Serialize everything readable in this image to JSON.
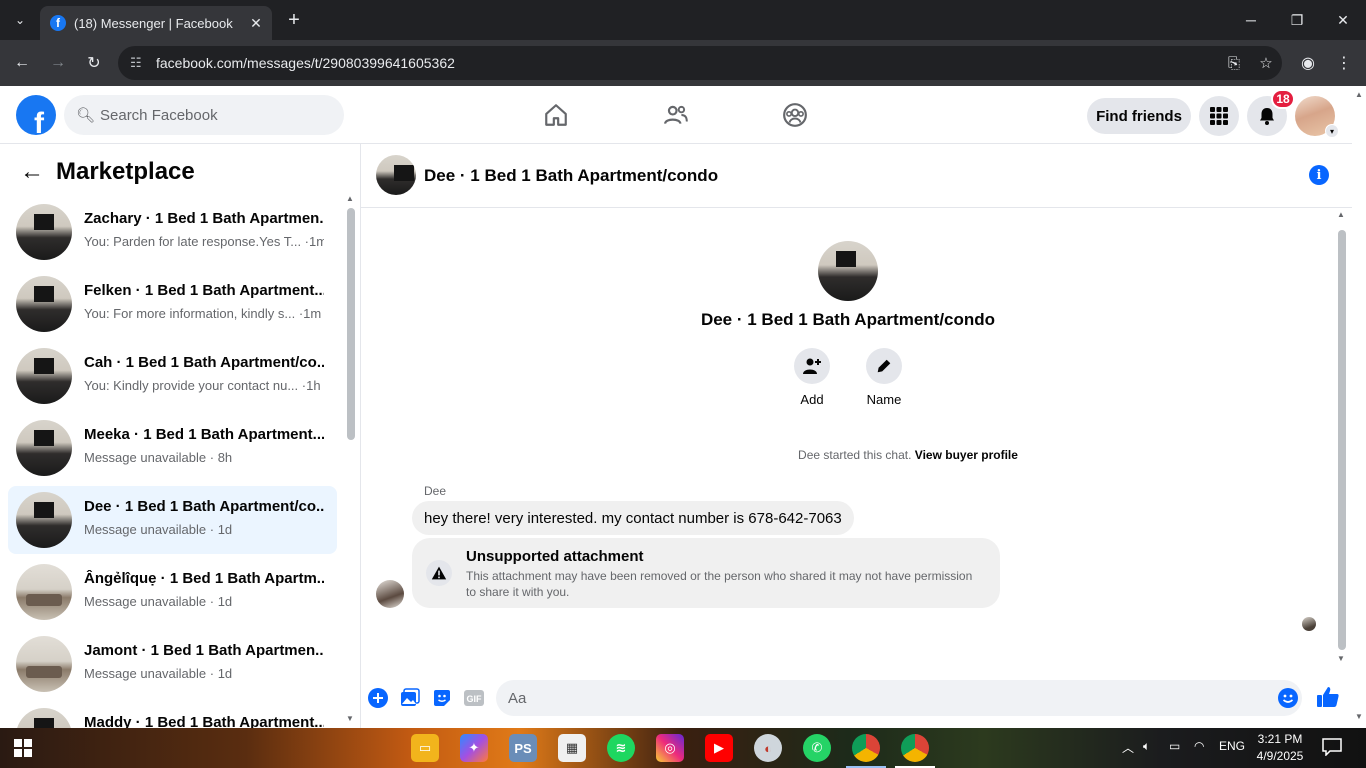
{
  "browser": {
    "tab_title": "(18) Messenger | Facebook",
    "url": "facebook.com/messages/t/29080399641605362"
  },
  "fb_header": {
    "search_placeholder": "Search Facebook",
    "find_friends_label": "Find friends",
    "notification_count": "18"
  },
  "sidebar": {
    "title": "Marketplace",
    "conversations": [
      {
        "name": "Zachary · 1 Bed 1 Bath Apartmen...",
        "snippet": "You: Parden for late response.Yes T... ·1m",
        "thumb": "dark"
      },
      {
        "name": "Felken · 1 Bed 1 Bath Apartment...",
        "snippet": "You: For more information, kindly s... ·1m",
        "thumb": "dark"
      },
      {
        "name": "Cah · 1 Bed 1 Bath Apartment/co...",
        "snippet": "You: Kindly provide your contact nu... ·1h",
        "thumb": "dark"
      },
      {
        "name": "Meeka · 1 Bed 1 Bath Apartment...",
        "snippet": "Message unavailable · 8h",
        "thumb": "dark"
      },
      {
        "name": "Dee · 1 Bed 1 Bath Apartment/co...",
        "snippet": "Message unavailable · 1d",
        "thumb": "dark",
        "active": true
      },
      {
        "name": "Ângẻlîquẹ · 1 Bed 1 Bath Apartm...",
        "snippet": "Message unavailable · 1d",
        "thumb": "light"
      },
      {
        "name": "Jamont · 1 Bed 1 Bath Apartmen...",
        "snippet": "Message unavailable · 1d",
        "thumb": "light"
      },
      {
        "name": "Maddy · 1 Bed 1 Bath Apartment...",
        "snippet": "",
        "thumb": "dark"
      }
    ]
  },
  "chat": {
    "header_title": "Dee · 1 Bed 1 Bath Apartment/condo",
    "profile_name": "Dee · 1 Bed 1 Bath Apartment/condo",
    "actions": {
      "add": "Add",
      "name": "Name"
    },
    "started_text": "Dee started this chat.",
    "view_buyer_profile": "View buyer profile",
    "sender": "Dee",
    "message": "hey there! very interested. my contact number is 678-642-7063",
    "attachment_title": "Unsupported attachment",
    "attachment_desc": "This attachment may have been removed or the person who shared it may not have permission to share it with you.",
    "composer_placeholder": "Aa"
  },
  "taskbar": {
    "time": "3:21 PM",
    "date": "4/9/2025",
    "lang": "ENG",
    "apps": [
      "file-explorer",
      "copilot",
      "ps",
      "store",
      "spotify",
      "instagram",
      "youtube",
      "app-round",
      "whatsapp",
      "chrome",
      "chrome-profile"
    ]
  },
  "colors": {
    "fb_blue": "#1877f2",
    "active_row": "#ebf5ff",
    "badge_red": "#e41e3f"
  }
}
